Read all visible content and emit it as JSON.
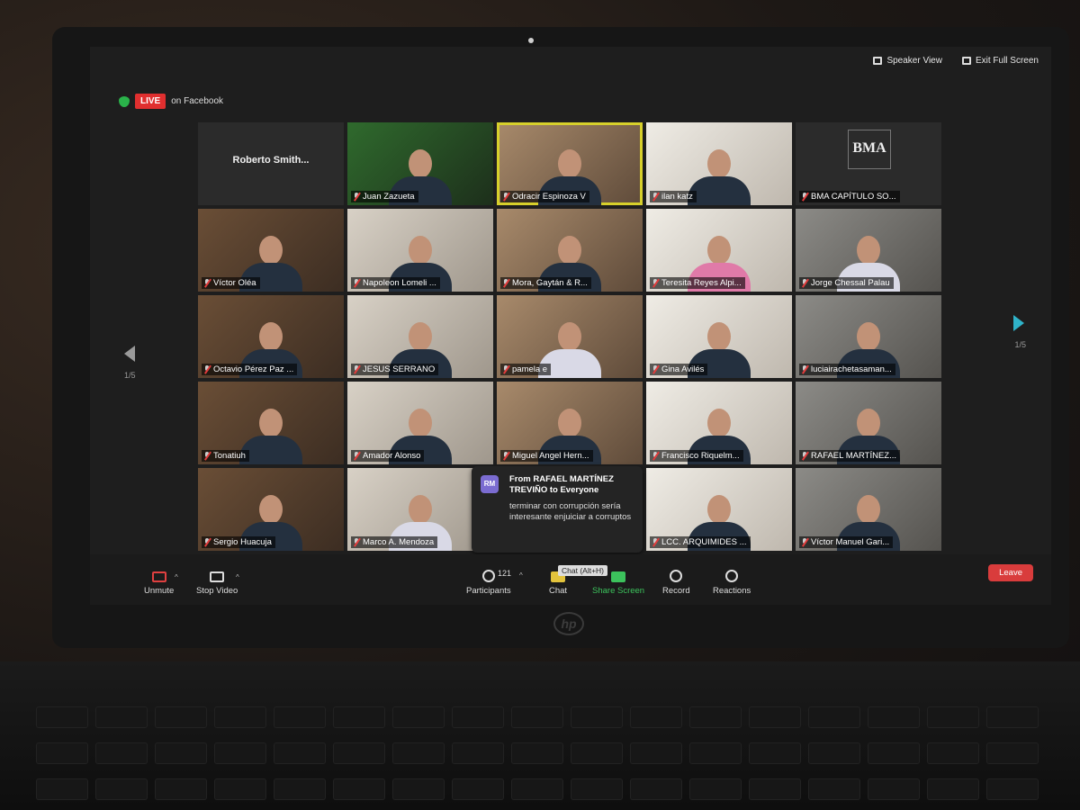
{
  "live": {
    "badge": "LIVE",
    "text": "on Facebook"
  },
  "view": {
    "speaker_view": "Speaker View",
    "exit_full_screen": "Exit Full Screen"
  },
  "pages": {
    "left": "1/5",
    "right": "1/5"
  },
  "tiles": [
    {
      "name": "Roberto Smith...",
      "style": "name-only"
    },
    {
      "name": "Juan Zazueta",
      "style": "video"
    },
    {
      "name": "Odracir Espinoza V",
      "style": "video-active"
    },
    {
      "name": "ilan katz",
      "style": "video"
    },
    {
      "name": "BMA CAPÍTULO SO...",
      "style": "logo",
      "logo_text": "BMA"
    },
    {
      "name": "Víctor Oléa",
      "style": "video"
    },
    {
      "name": "Napoleon Lomeli ...",
      "style": "video"
    },
    {
      "name": "Mora, Gaytán & R...",
      "style": "video"
    },
    {
      "name": "Teresita Reyes Alpi...",
      "style": "video"
    },
    {
      "name": "Jorge Chessal Palau",
      "style": "video"
    },
    {
      "name": "Octavio Pérez Paz ...",
      "style": "video"
    },
    {
      "name": "JESUS SERRANO",
      "style": "video"
    },
    {
      "name": "pamela e",
      "style": "video"
    },
    {
      "name": "Gina Avilés",
      "style": "video"
    },
    {
      "name": "luciairachetasaman...",
      "style": "video"
    },
    {
      "name": "Tonatiuh",
      "style": "video"
    },
    {
      "name": "Amador Alonso",
      "style": "video"
    },
    {
      "name": "Miguel Angel Hern...",
      "style": "video"
    },
    {
      "name": "Francisco Riquelm...",
      "style": "video"
    },
    {
      "name": "RAFAEL MARTÍNEZ...",
      "style": "video"
    },
    {
      "name": "Sergio Huacuja",
      "style": "video"
    },
    {
      "name": "Marco A. Mendoza",
      "style": "video"
    },
    {
      "name": "",
      "style": "hidden"
    },
    {
      "name": "LCC. ARQUIMIDES ...",
      "style": "video"
    },
    {
      "name": "Víctor Manuel Gari...",
      "style": "video"
    }
  ],
  "chat_popup": {
    "avatar": "RM",
    "from": "From RAFAEL MARTÍNEZ TREVIÑO to Everyone",
    "message": "terminar con corrupción sería interesante enjuiciar a corruptos"
  },
  "toolbar": {
    "unmute": "Unmute",
    "stop_video": "Stop Video",
    "participants": "Participants",
    "participants_count": "121",
    "chat": "Chat",
    "chat_tooltip": "Chat (Alt+H)",
    "share_screen": "Share Screen",
    "record": "Record",
    "reactions": "Reactions",
    "leave": "Leave"
  },
  "colors": {
    "active_speaker": "#d7d02b",
    "leave": "#d93c3c",
    "share": "#3cc35c",
    "live": "#e02f2f"
  }
}
